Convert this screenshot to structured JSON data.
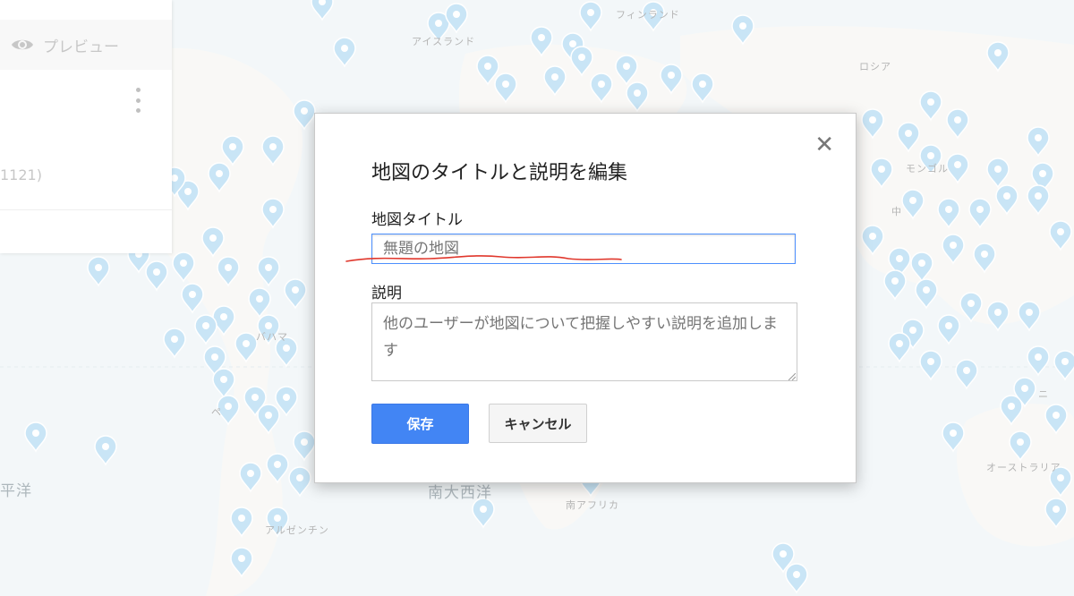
{
  "sidebar": {
    "preview_label": "プレビュー",
    "preview_icon": "eye-icon",
    "layer_count": "1121)",
    "menu_icon": "more-vert-icon"
  },
  "map": {
    "water_color": "#e9f1f4",
    "land_color": "#f4f3ef",
    "pin_color": "#9dd0ee",
    "labels": {
      "iceland": "アイスランド",
      "finland": "フィンランド",
      "russia": "ロシア",
      "mongolia": "モンゴル",
      "china": "中",
      "bahamas": "バハマ",
      "pacific": "平洋",
      "atlantic_south": "南大西洋",
      "south_africa": "南アフリカ",
      "argentina": "アルゼンチン",
      "australia": "オーストラリア",
      "peru": "ペ",
      "new_guinea": "ニ"
    }
  },
  "dialog": {
    "title": "地図のタイトルと説明を編集",
    "close_icon": "close-icon",
    "title_field_label": "地図タイトル",
    "title_field_placeholder": "無題の地図",
    "title_field_value": "",
    "description_label": "説明",
    "description_placeholder": "他のユーザーが地図について把握しやすい説明を追加します",
    "save_label": "保存",
    "cancel_label": "キャンセル",
    "accent_color": "#4285f4"
  }
}
